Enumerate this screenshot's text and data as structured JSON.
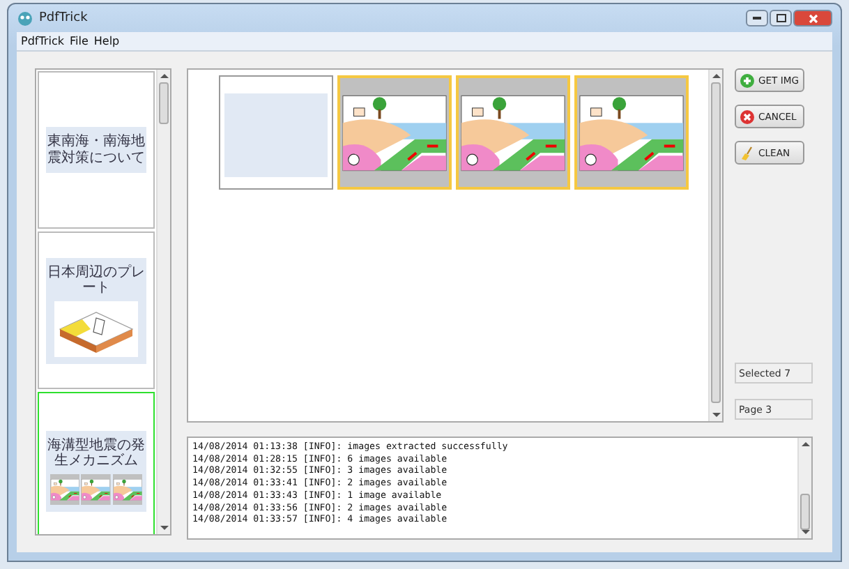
{
  "window": {
    "title": "PdfTrick"
  },
  "menu": [
    "PdfTrick",
    "File",
    "Help"
  ],
  "pages": [
    {
      "kind": "title",
      "title": "東南海・南海地震対策について",
      "selected": false
    },
    {
      "kind": "map",
      "title": "日本周辺のプレート",
      "selected": false
    },
    {
      "kind": "diagrams",
      "title": "海溝型地震の発生メカニズム",
      "selected": true
    }
  ],
  "images": [
    {
      "kind": "blank",
      "selected": false
    },
    {
      "kind": "diagram",
      "selected": true
    },
    {
      "kind": "diagram",
      "selected": true
    },
    {
      "kind": "diagram",
      "selected": true
    }
  ],
  "buttons": [
    {
      "kind": "add",
      "label": "GET IMG"
    },
    {
      "kind": "cancel",
      "label": "CANCEL"
    },
    {
      "kind": "clean",
      "label": "CLEAN"
    }
  ],
  "selected_count": "Selected 7",
  "page": "Page 3",
  "log": [
    "14/08/2014 01:13:38 [INFO]: images extracted successfully",
    "14/08/2014 01:28:15 [INFO]: 6 images available",
    "14/08/2014 01:32:55 [INFO]: 3 images available",
    "14/08/2014 01:33:41 [INFO]: 2 images available",
    "14/08/2014 01:33:43 [INFO]: 1 image available",
    "14/08/2014 01:33:56 [INFO]: 2 images available",
    "14/08/2014 01:33:57 [INFO]: 4 images available"
  ]
}
